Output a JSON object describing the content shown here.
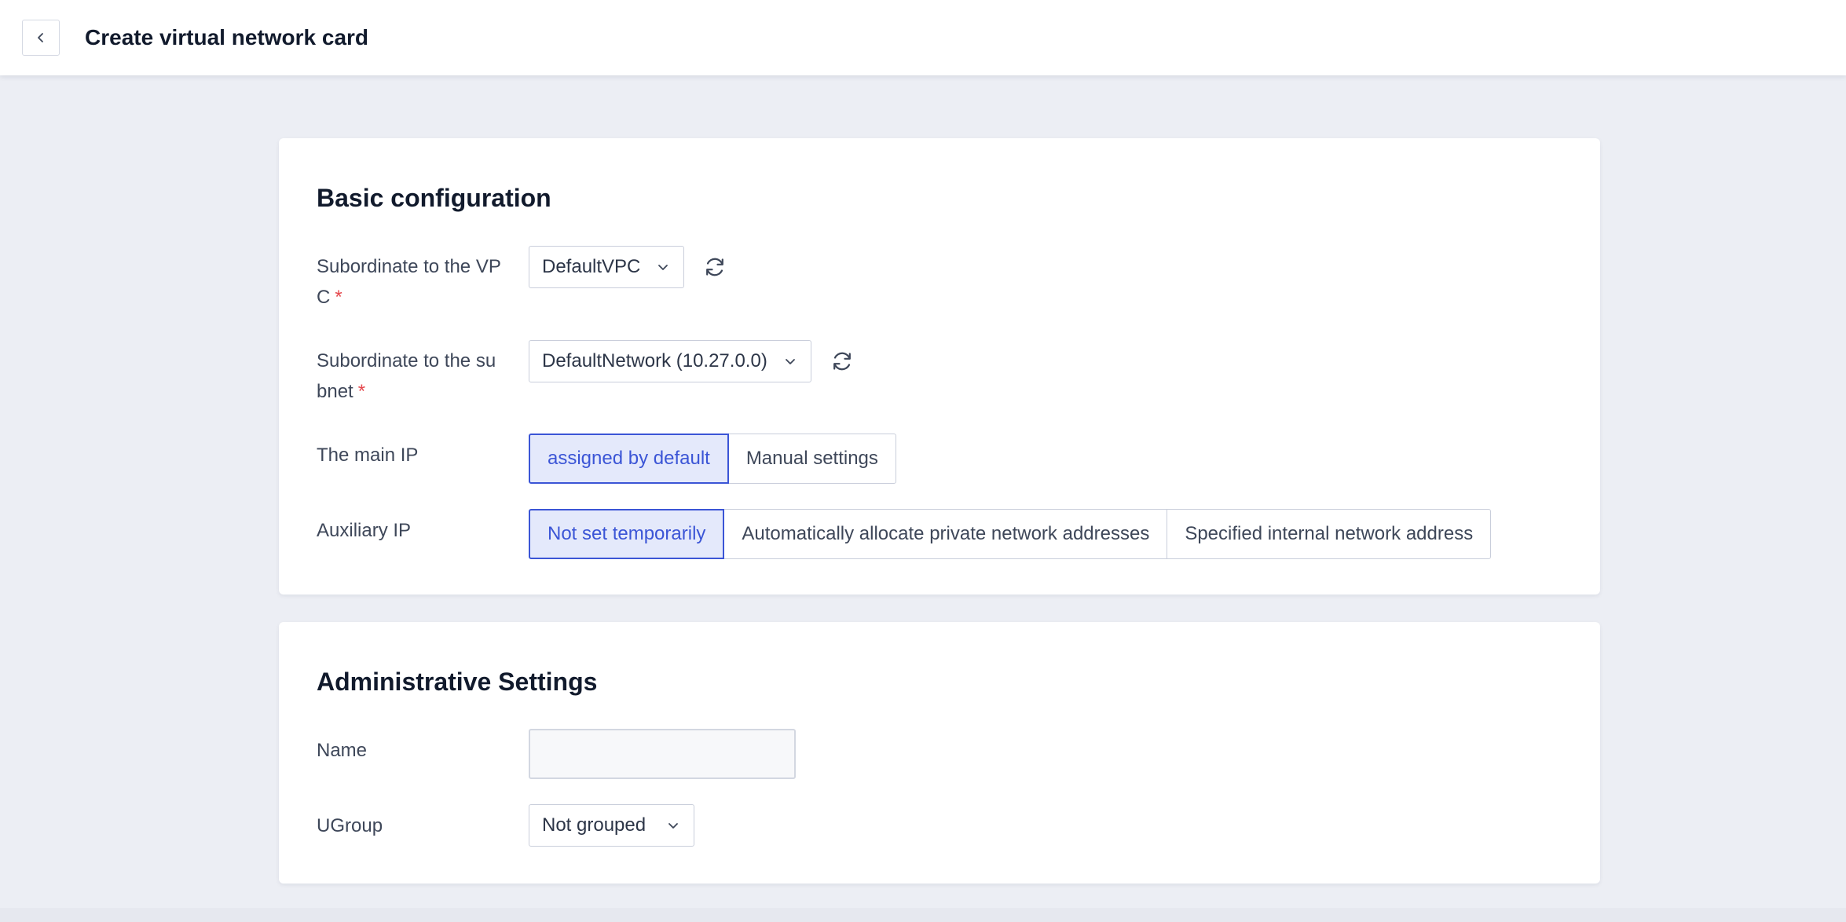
{
  "header": {
    "title": "Create virtual network card"
  },
  "basic": {
    "title": "Basic configuration",
    "vpc": {
      "label_line1": "Subordinate to the VP",
      "label_line2": "C",
      "required_mark": "*",
      "value": "DefaultVPC"
    },
    "subnet": {
      "label_line1": "Subordinate to the su",
      "label_line2": "bnet",
      "required_mark": "*",
      "value": "DefaultNetwork (10.27.0.0)"
    },
    "main_ip": {
      "label": "The main IP",
      "options": [
        "assigned by default",
        "Manual settings"
      ],
      "selected_index": 0
    },
    "aux_ip": {
      "label": "Auxiliary IP",
      "options": [
        "Not set temporarily",
        "Automatically allocate private network addresses",
        "Specified internal network address"
      ],
      "selected_index": 0
    }
  },
  "admin": {
    "title": "Administrative Settings",
    "name": {
      "label": "Name",
      "value": ""
    },
    "ugroup": {
      "label": "UGroup",
      "value": "Not grouped"
    }
  },
  "colors": {
    "accent": "#3b55d6",
    "accent_bg": "#e4e9fb",
    "required": "#e5484d",
    "page_bg": "#eceef4"
  },
  "icons": {
    "back": "chevron-left-icon",
    "dropdown": "chevron-down-icon",
    "refresh": "refresh-icon"
  }
}
